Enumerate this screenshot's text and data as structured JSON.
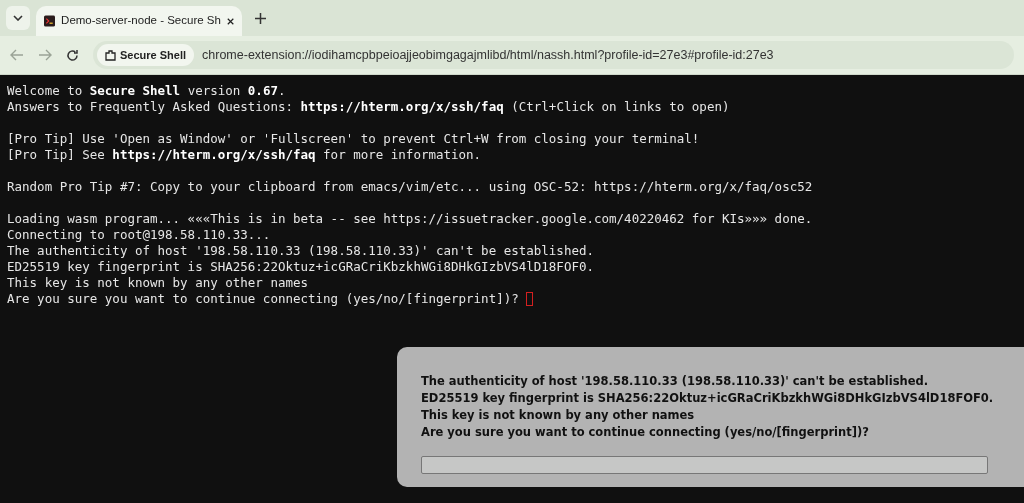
{
  "tabs": [
    {
      "title": "Demo-server-node - Secure Sh",
      "selected": true
    }
  ],
  "address_bar": {
    "site_chip": "Secure Shell",
    "url": "chrome-extension://iodihamcpbpeioajjeobimgagajmlibd/html/nassh.html?profile-id=27e3#profile-id:27e3"
  },
  "terminal": {
    "blocks": [
      [
        "Welcome to **Secure Shell** version **0.67**.",
        "Answers to Frequently Asked Questions: **https://hterm.org/x/ssh/faq** (Ctrl+Click on links to open)"
      ],
      [
        "[Pro Tip] Use 'Open as Window' or 'Fullscreen' to prevent Ctrl+W from closing your terminal!",
        "[Pro Tip] See **https://hterm.org/x/ssh/faq** for more information."
      ],
      [
        "Random Pro Tip #7: Copy to your clipboard from emacs/vim/etc... using OSC-52: https://hterm.org/x/faq/osc52"
      ],
      [
        "Loading wasm program... «««This is in beta -- see https://issuetracker.google.com/40220462 for KIs»»» done.",
        "Connecting to root@198.58.110.33...",
        "The authenticity of host '198.58.110.33 (198.58.110.33)' can't be established.",
        "ED25519 key fingerprint is SHA256:22Oktuz+icGRaCriKbzkhWGi8DHkGIzbVS4lD18FOF0.",
        "This key is not known by any other names",
        "Are you sure you want to continue connecting (yes/no/[fingerprint])? "
      ]
    ],
    "cursor": true
  },
  "prompt_dialog": {
    "lines": [
      "The authenticity of host '198.58.110.33 (198.58.110.33)' can't be established.",
      "ED25519 key fingerprint is SHA256:22Oktuz+icGRaCriKbzkhWGi8DHkGIzbVS4lD18FOF0.",
      "This key is not known by any other names",
      "Are you sure you want to continue connecting (yes/no/[fingerprint])?"
    ]
  }
}
